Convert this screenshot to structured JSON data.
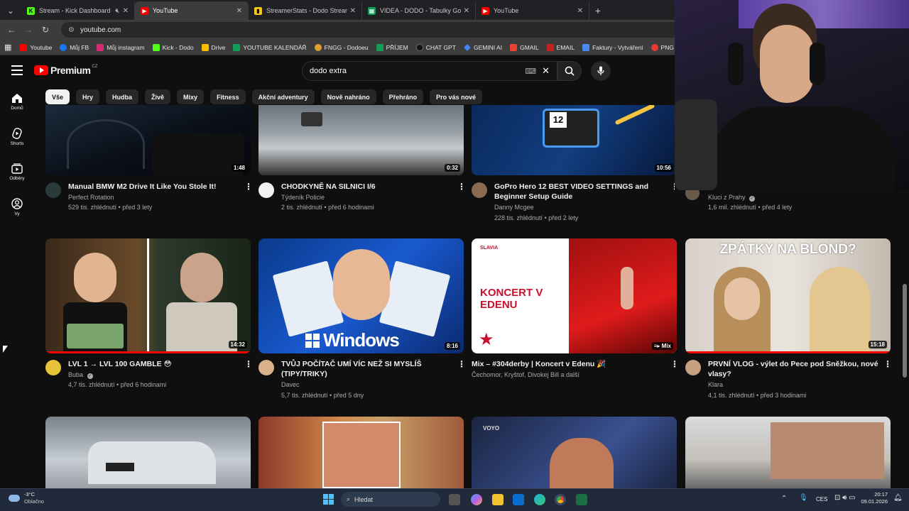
{
  "tabs": [
    {
      "label": "Stream - Kick Dashboard",
      "fav": "K",
      "favcolor": "#53fc18",
      "active": false
    },
    {
      "label": "YouTube",
      "fav": "▶",
      "favcolor": "#ff0000",
      "active": true
    },
    {
      "label": "StreamerStats - Dodo Stream E",
      "fav": "▮",
      "favcolor": "#f5c518",
      "active": false
    },
    {
      "label": "VIDEA - DODO - Tabulky Googl",
      "fav": "▦",
      "favcolor": "#0f9d58",
      "active": false
    },
    {
      "label": "YouTube",
      "fav": "▶",
      "favcolor": "#ff0000",
      "active": false
    }
  ],
  "address": {
    "url": "youtube.com"
  },
  "bookmarks": [
    {
      "label": "Youtube",
      "color": "#ff0000"
    },
    {
      "label": "Můj FB",
      "color": "#1877f2"
    },
    {
      "label": "Můj instagram",
      "color": "#d62976"
    },
    {
      "label": "Kick - Dodo",
      "color": "#53fc18"
    },
    {
      "label": "Drive",
      "color": "#fbbc04"
    },
    {
      "label": "YOUTUBE KALENDÁŘ",
      "color": "#0f9d58"
    },
    {
      "label": "FNGG - Dodoeu",
      "color": "#e0a030"
    },
    {
      "label": "PŘÍJEM",
      "color": "#0f9d58"
    },
    {
      "label": "CHAT GPT",
      "color": "#222222"
    },
    {
      "label": "GEMINI AI",
      "color": "#4285f4"
    },
    {
      "label": "GMAIL",
      "color": "#ea4335"
    },
    {
      "label": "EMAIL",
      "color": "#c5221f"
    },
    {
      "label": "Faktury - Vytváření",
      "color": "#4a8af4"
    },
    {
      "label": "PNG to PD",
      "color": "#e53935"
    }
  ],
  "youtube": {
    "logo": "Premium",
    "region": "CZ",
    "search_value": "dodo extra"
  },
  "sidebar": [
    {
      "label": "Domů"
    },
    {
      "label": "Shorts"
    },
    {
      "label": "Odběry"
    },
    {
      "label": "Vy"
    }
  ],
  "chips": [
    "Vše",
    "Hry",
    "Hudba",
    "Živě",
    "Mixy",
    "Fitness",
    "Akční adventury",
    "Nově nahráno",
    "Přehráno",
    "Pro vás nové"
  ],
  "row1": [
    {
      "title": "Manual BMW M2 Drive It Like You Stole It!",
      "channel": "Perfect Rotation",
      "meta": "529 tis. zhlédnutí • před 3 lety",
      "duration": "1:48"
    },
    {
      "title": "CHODKYNĚ NA SILNICI I/6",
      "channel": "Týdeník Policie",
      "meta": "2 tis. zhlédnutí • před 6 hodinami",
      "duration": "0:32"
    },
    {
      "title": "GoPro Hero 12 BEST VIDEO SETTINGS and Beginner Setup Guide",
      "channel": "Danny Mcgee",
      "meta": "228 tis. zhlédnutí • před 2 lety",
      "duration": "10:56"
    },
    {
      "title": "",
      "channel": "Kluci z Prahy",
      "meta": "1,6 mil. zhlédnutí • před 4 lety",
      "duration": ""
    }
  ],
  "row2": [
    {
      "title": "LVL 1 → LVL 100 GAMBLE 😳",
      "channel": "Buba",
      "meta": "4,7 tis. zhlédnutí • před 6 hodinami",
      "duration": "14:32",
      "thumbtext": ""
    },
    {
      "title": "TVŮJ POČÍTAČ UMÍ VÍC NEŽ SI MYSLÍŠ (TIPY/TRIKY)",
      "channel": "Davec",
      "meta": "5,7 tis. zhlédnutí • před 5 dny",
      "duration": "8:16",
      "thumbtext": "Windows"
    },
    {
      "title": "Mix – #304derby | Koncert v Edenu 🎉",
      "channel": "Čechomor, Kryštof, Divokej Bill a další",
      "meta": "",
      "duration": "Mix",
      "thumbtext": "KONCERT V EDENU",
      "thumbtag": "SLAVIA"
    },
    {
      "title": "PRVNÍ VLOG - výlet do Pece pod Sněžkou, nové vlasy?",
      "channel": "Klara",
      "meta": "4,1 tis. zhlédnutí • před 3 hodinami",
      "duration": "15:18",
      "thumbtext": "ZPÁTKY NA BLOND?"
    }
  ],
  "row3_tag": "VOYO",
  "taskbar": {
    "weather_temp": "-3°C",
    "weather_desc": "Oblačno",
    "search": "Hledat",
    "lang": "CES",
    "time": "20:17",
    "date": "09.01.2026"
  },
  "colors": {
    "accent": "#ff0000",
    "bg": "#0f0f0f",
    "chip": "#272727"
  }
}
